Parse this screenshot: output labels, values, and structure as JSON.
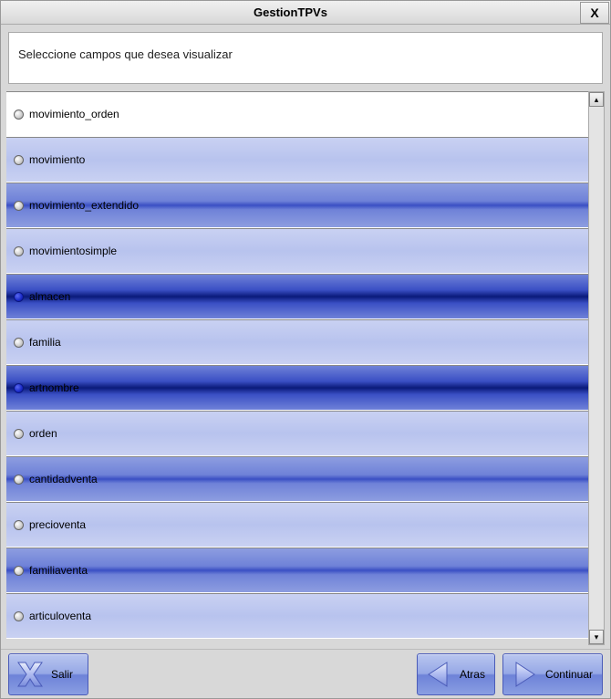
{
  "window": {
    "title": "GestionTPVs",
    "close": "X"
  },
  "instruction": "Seleccione campos que desea visualizar",
  "fields": [
    {
      "label": "movimiento_orden",
      "selected": false,
      "shade": 0
    },
    {
      "label": "movimiento",
      "selected": false,
      "shade": 1
    },
    {
      "label": "movimiento_extendido",
      "selected": false,
      "shade": 2
    },
    {
      "label": "movimientosimple",
      "selected": false,
      "shade": 1
    },
    {
      "label": "almacen",
      "selected": true,
      "shade": 2
    },
    {
      "label": "familia",
      "selected": false,
      "shade": 1
    },
    {
      "label": "artnombre",
      "selected": true,
      "shade": 2
    },
    {
      "label": "orden",
      "selected": false,
      "shade": 1
    },
    {
      "label": "cantidadventa",
      "selected": false,
      "shade": 2
    },
    {
      "label": "precioventa",
      "selected": false,
      "shade": 1
    },
    {
      "label": "familiaventa",
      "selected": false,
      "shade": 2
    },
    {
      "label": "articuloventa",
      "selected": false,
      "shade": 1
    }
  ],
  "footer": {
    "exit": "Salir",
    "back": "Atras",
    "next": "Continuar"
  },
  "scroll": {
    "up": "▴",
    "down": "▾"
  }
}
